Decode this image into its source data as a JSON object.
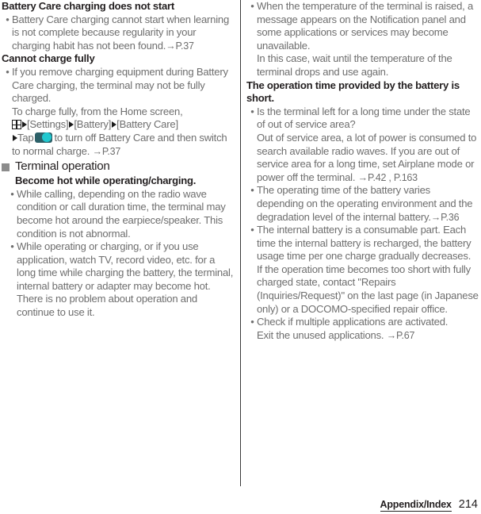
{
  "document": {
    "type": "user-manual-page",
    "page_number": "214",
    "footer_tab": "Appendix/Index",
    "text_color": "#6e6e6e",
    "heading_color": "#231f20",
    "toggle_track_color": "#2c6068",
    "toggle_knob_color": "#21c8cf",
    "section_square_color": "#8c8c8c"
  },
  "left_column": {
    "heading_1": "Battery Care charging does not start",
    "bullet_1": "Battery Care charging cannot start when learning is not complete because regularity in your charging habit has not been found.",
    "bullet_1_ref": "→P.37",
    "heading_2": "Cannot charge fully",
    "bullet_2_part1": "If you remove charging equipment during Battery Care charging, the terminal may not be fully charged.",
    "bullet_2_part2_pre": "To charge fully, from the Home screen,",
    "bullet_2_steps_1": "[Settings]",
    "bullet_2_steps_2": "[Battery]",
    "bullet_2_steps_3": "[Battery Care]",
    "bullet_2_steps_4": "Tap",
    "bullet_2_steps_5": "to turn off Battery Care and then switch to normal charge.",
    "bullet_2_ref": "→P.37",
    "icons": {
      "app_grid": "app-drawer-grid-icon",
      "step_arrow": "step-arrow-icon",
      "toggle": "battery-care-toggle-switch"
    },
    "section": {
      "title": "Terminal operation",
      "subheading": "Become hot while operating/charging.",
      "bullet_1": "While calling, depending on the radio wave condition or call duration time, the terminal may become hot around the earpiece/speaker. This condition is not abnormal.",
      "bullet_2": "While operating or charging, or if you use application, watch TV, record video, etc. for a long time while charging the battery, the terminal, internal battery or adapter may become hot. There is no problem about operation and continue to use it."
    }
  },
  "right_column": {
    "bullet_1_part1": "When the temperature of the terminal is raised, a message appears on the Notification panel and some applications or services may become unavailable.",
    "bullet_1_part2": "In this case, wait until the temperature of the terminal drops and use again.",
    "heading_1": "The operation time provided by the battery is short.",
    "bullet_2_part1": "Is the terminal left for a long time under the state of out of service area?",
    "bullet_2_part2": "Out of service area, a lot of power is consumed to search available radio waves. If you are out of service area for a long time, set Airplane mode or power off the terminal.",
    "bullet_2_ref": "→P.42 , P.163",
    "bullet_3": "The operating time of the battery varies depending on the operating environment and the degradation level of the internal battery.",
    "bullet_3_ref": "→P.36",
    "bullet_4_part1": "The internal battery is a consumable part. Each time the internal battery is recharged, the battery usage time per one charge gradually decreases.",
    "bullet_4_part2": "If the operation time becomes too short with fully charged state, contact \"Repairs (Inquiries/Request)\" on the last page (in Japanese only) or a DOCOMO-specified repair office.",
    "bullet_5_part1": "Check if multiple applications are activated.",
    "bullet_5_part2": "Exit the unused applications.",
    "bullet_5_ref": "→P.67"
  },
  "bullet_glyph": "•"
}
